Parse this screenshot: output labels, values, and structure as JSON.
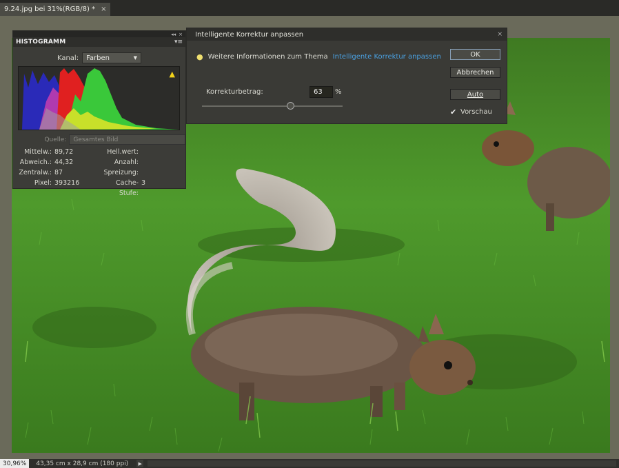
{
  "document_tab": {
    "title": "9.24.jpg bei 31%(RGB/8) *",
    "close_symbol": "×"
  },
  "histogram_panel": {
    "title": "HISTOGRAMM",
    "collapse_symbol": "◂◂",
    "close_symbol": "×",
    "menu_symbol": "▾≡",
    "channel_label": "Kanal:",
    "channel_value": "Farben",
    "source_label": "Quelle:",
    "source_value": "Gesamtes Bild",
    "warning_icon": "warning-triangle",
    "stats_left": [
      {
        "label": "Mittelw.:",
        "value": "89,72"
      },
      {
        "label": "Abweich.:",
        "value": "44,32"
      },
      {
        "label": "Zentralw.:",
        "value": "87"
      },
      {
        "label": "Pixel:",
        "value": "393216"
      }
    ],
    "stats_right": [
      {
        "label": "Hell.wert:",
        "value": ""
      },
      {
        "label": "Anzahl:",
        "value": ""
      },
      {
        "label": "Spreizung:",
        "value": ""
      },
      {
        "label": "Cache-Stufe:",
        "value": "3"
      }
    ]
  },
  "dialog": {
    "title": "Intelligente Korrektur anpassen",
    "close_symbol": "×",
    "info_text": "Weitere Informationen zum Thema",
    "info_link": "Intelligente Korrektur anpassen",
    "amount_label": "Korrekturbetrag:",
    "amount_value": "63",
    "amount_unit": "%",
    "slider_percent": 63,
    "ok_label": "OK",
    "cancel_label": "Abbrechen",
    "auto_label": "Auto",
    "preview_label": "Vorschau",
    "preview_checked": true
  },
  "statusbar": {
    "zoom": "30,96%",
    "doc_size": "43,35 cm x 28,9 cm (180 ppi)",
    "arrow": "▶"
  },
  "colors": {
    "link": "#4aa0e0",
    "warning": "#f2d21a",
    "panel_bg": "#3c3c38",
    "canvas_bg": "#6a6a5a"
  }
}
